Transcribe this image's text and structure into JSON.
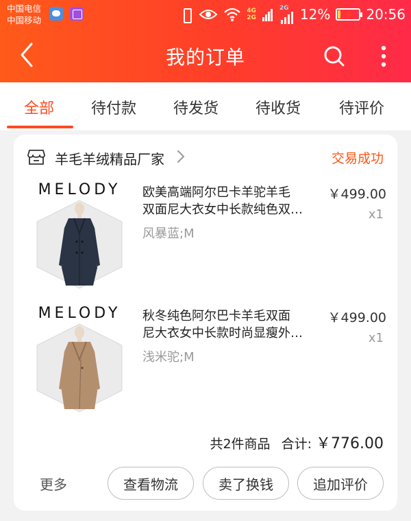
{
  "status_bar": {
    "carrier_1": "中国电信",
    "carrier_2": "中国移动",
    "net_top": "4G",
    "net_bottom": "2G",
    "net_2g": "2G",
    "battery_percent": "12%",
    "time": "20:56",
    "battery_level": 0.12
  },
  "nav": {
    "title": "我的订单"
  },
  "tabs": [
    {
      "label": "全部",
      "active": true
    },
    {
      "label": "待付款",
      "active": false
    },
    {
      "label": "待发货",
      "active": false
    },
    {
      "label": "待收货",
      "active": false
    },
    {
      "label": "待评价",
      "active": false
    }
  ],
  "order": {
    "shop_name": "羊毛羊绒精品厂家",
    "status": "交易成功",
    "items": [
      {
        "brand": "MELODY",
        "title_line1": "欧美高端阿尔巴卡羊驼羊毛",
        "title_line2": "双面尼大衣女中长款纯色双…",
        "variant": "风暴蓝;M",
        "price": "￥499.00",
        "qty": "x1",
        "coat_color": "#2b3444"
      },
      {
        "brand": "MELODY",
        "title_line1": "秋冬纯色阿尔巴卡羊毛双面",
        "title_line2": "尼大衣女中长款时尚显瘦外…",
        "variant": "浅米驼;M",
        "price": "￥499.00",
        "qty": "x1",
        "coat_color": "#b48f6e"
      }
    ],
    "summary_count": "共2件商品",
    "summary_total_label": "合计:",
    "summary_total_amount": "￥776.00"
  },
  "actions": {
    "more": "更多",
    "logistics": "查看物流",
    "resell": "卖了换钱",
    "review": "追加评价"
  },
  "colors": {
    "accent": "#ff4a1e",
    "status_orange": "#ff5511"
  }
}
